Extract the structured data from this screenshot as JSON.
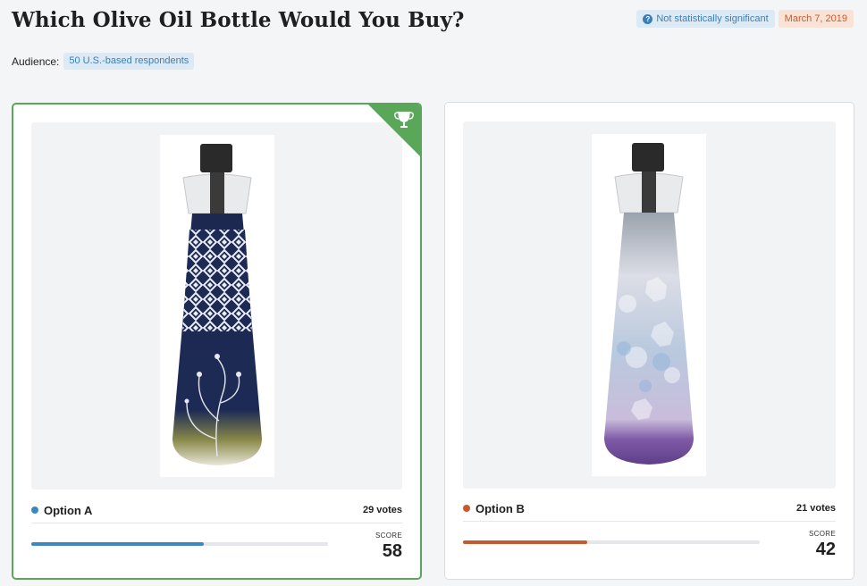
{
  "header": {
    "title": "Which Olive Oil Bottle Would You Buy?",
    "significance": "Not statistically significant",
    "date": "March 7, 2019"
  },
  "audience": {
    "label": "Audience:",
    "value": "50 U.S.-based respondents"
  },
  "options": [
    {
      "name": "Option A",
      "votes": "29 votes",
      "score_label": "SCORE",
      "score": "58",
      "score_fraction": 0.58,
      "color": "#3b87c3",
      "winner": true,
      "winner_icon": "trophy-icon"
    },
    {
      "name": "Option B",
      "votes": "21 votes",
      "score_label": "SCORE",
      "score": "42",
      "score_fraction": 0.42,
      "color": "#c8592c",
      "winner": false
    }
  ],
  "colors": {
    "winner_border": "#5aa75a",
    "badge_blue": "#3b7fb6",
    "badge_orange": "#c85c2c"
  }
}
